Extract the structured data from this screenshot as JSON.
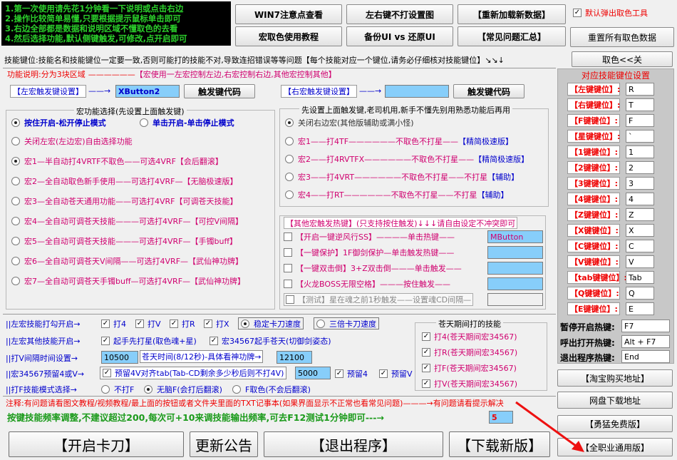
{
  "intro_lines": [
    "1.第一次使用请先花1分钟看一下说明或点击右边",
    "2.操作比较简单易懂,只要根据提示鼠标单击即可",
    "3.右边全部都是数据和说明区域不懂取色的去看",
    "4.然后选择功能,默认侧键触发,可修改,点开启即可"
  ],
  "top_buttons": {
    "win7": "WIN7注意点查看",
    "lr_key": "左右键不打设置图",
    "reload": "【重新加载新数据】",
    "macro_tutorial": "宏取色使用教程",
    "backup_ui": "备份UI vs 还原UI",
    "faq": "【常见问题汇总】"
  },
  "default_popup": "默认弹出取色工具",
  "reset_colors": "重置所有取色数据",
  "pick_color": "取色<<关",
  "skill_note": "技能键位:技能名和技能键位一定要一致,否则可能打的技能不对,导致连招错误等等问题【每个技能对应一个键位,请务必仔细核对技能键位】↘↘↓",
  "func_note_a": "功能说明:分为3块区域",
  "func_note_b": "【宏使用一左宏控制左边,右宏控制右边,其他宏控制其他】",
  "left_trigger": {
    "label": "【左宏触发键设置】",
    "arrow": "——→",
    "value": "XButton2",
    "code_btn": "触发键代码"
  },
  "right_trigger": {
    "label": "【右宏触发键设置】",
    "arrow": "——→",
    "value": "",
    "code_btn": "触发键代码"
  },
  "left_group": {
    "title": "宏功能选择(先设置上面触发键)",
    "opt_hold": "按住开启-松开停止模式",
    "opt_click": "单击开启-单击停止模式",
    "items": [
      {
        "a": "关闭左宏(左边宏)自由选择功能",
        "b": ""
      },
      {
        "a": "宏1—半自动打4VRTF不取色——可选4VRF",
        "b": "【会后翻滚】"
      },
      {
        "a": "宏2—全自动取色新手使用——可选打4VRF—",
        "b": "【无脑极速版】"
      },
      {
        "a": "宏3—全自动苍天通用功能——可选打4VRF",
        "b": "【可调苍天技能】"
      },
      {
        "a": "宏4—全自动可调苍天技能———可选打4VRF—",
        "b": "【可控V间隔】"
      },
      {
        "a": "宏5—全自动可调苍天技能———可选打4VRF—",
        "b": "【手镯buff】"
      },
      {
        "a": "宏6—全自动可调苍天V间隔——可选打4VRF—",
        "b": "【武仙神功牌】"
      },
      {
        "a": "宏7—全自动可调苍天手镯buff—可选打4VRF—",
        "b": "【武仙神功牌】"
      }
    ]
  },
  "right_group": {
    "title": "先设置上面触发键,老司机用,新手不懂先别用熟悉功能后再用",
    "items": [
      {
        "a": "关闭右边宏(其他版辅助或满小怪)",
        "b": "",
        "c": ""
      },
      {
        "a": "宏1——打4TF——————",
        "b": "不取色不打星——",
        "c": "【精简极速版】"
      },
      {
        "a": "宏2——打4RVTFX——————",
        "b": "不取色不打星——",
        "c": "【精简极速版】"
      },
      {
        "a": "宏3——打4VRT——————",
        "b": "不取色不打星——不打星",
        "c": "【辅助】"
      },
      {
        "a": "宏4——打RT——————",
        "b": "不取色不打星——不打星",
        "c": "【辅助】"
      }
    ]
  },
  "other_hotkeys": {
    "title": "【其他宏触发热键】(只支持按住触发)↓↓↓请自由设定不冲突即可",
    "items": [
      {
        "label": "【开启一键逆风行SS】",
        "mid": "————单击热键——",
        "value": "MButton",
        "checked": false
      },
      {
        "label": "【一键保护】1F御剑保护—",
        "mid": "单击触发热键——",
        "value": "",
        "checked": false
      },
      {
        "label": "【一键双击倒】3+Z双击倒",
        "mid": "———单击触发——",
        "value": "",
        "checked": false
      },
      {
        "label": "【火龙BOSS无限空格】",
        "mid": "———按住触发——",
        "value": "",
        "checked": false
      },
      {
        "label": "【测试】星在魂之前1秒触发——设置魂CD间隔—",
        "mid": "",
        "value": "",
        "checked": false
      }
    ]
  },
  "bottom_rows": {
    "r1_label": "||左宏技能打勾开启→",
    "r1_skills": [
      "打4",
      "打V",
      "打R",
      "打X"
    ],
    "r1_opt1": "稳定卡刀速度",
    "r1_opt2": "三倍卡刀速度",
    "r2_label": "||左宏其他技能开启→",
    "r2_opt1": "起手先打星(取色魂+星)",
    "r2_opt2": "宏34567起手苍天(切御剑姿态)",
    "r3_label": "||打V间隔时间设置→",
    "r3_val1": "10500",
    "r3_mid": "苍天时间(8/12秒)-具体看神功牌→",
    "r3_val2": "12100",
    "r4_label": "||宏34567预留4或V→",
    "r4_opt1": "预留4V对齐tab(Tab-CD剩余多少秒后则不打4V)",
    "r4_val": "5000",
    "r4_opt2": "预留4",
    "r4_opt3": "预留V",
    "r5_label": "||打F技能模式选择→",
    "r5_opt1": "不打F",
    "r5_opt2": "无脑F(会打后翻滚)",
    "r5_opt3": "F取色(不会后翻滚)"
  },
  "cangtian": {
    "title": "苍天期间打的技能",
    "items": [
      "打4(苍天期间宏34567)",
      "打R(苍天期间宏34567)",
      "打F(苍天期间宏34567)",
      "打V(苍天期间宏34567)"
    ]
  },
  "note_line": "注释:有问题请看图文教程/视频教程/最上面的按钮或者文件夹里面的TXT记事本(如果界面显示不正常也看常见问题)———→有问题请看提示解决",
  "freq_line": "按键技能频率调整,不建议超过200,每次可+10来调技能输出频率,可去F12测试1分钟即可---→",
  "freq_value": "5",
  "bottom_buttons": {
    "start": "【开启卡刀】",
    "update": "更新公告",
    "exit": "【退出程序】",
    "download": "【下载新版】"
  },
  "side": {
    "title": "对应技能键位设置",
    "keys": [
      {
        "label": "【左键键位】:",
        "value": "R"
      },
      {
        "label": "【右键键位】:",
        "value": "T"
      },
      {
        "label": "【F键键位】:",
        "value": "F"
      },
      {
        "label": "【星键键位】:",
        "value": "`"
      },
      {
        "label": "【1键键位】:",
        "value": "1"
      },
      {
        "label": "【2键键位】:",
        "value": "2"
      },
      {
        "label": "【3键键位】:",
        "value": "3"
      },
      {
        "label": "【4键键位】:",
        "value": "4"
      },
      {
        "label": "【Z键键位】:",
        "value": "Z"
      },
      {
        "label": "【X键键位】:",
        "value": "X"
      },
      {
        "label": "【C键键位】:",
        "value": "C"
      },
      {
        "label": "【V键键位】:",
        "value": "V"
      },
      {
        "label": "【tab键键位】:",
        "value": "Tab"
      },
      {
        "label": "【Q键键位】:",
        "value": "Q"
      },
      {
        "label": "【E键键位】:",
        "value": "E"
      }
    ],
    "pause_label": "暂停开启热键:",
    "pause_value": "F7",
    "call_label": "呼出打开热键:",
    "call_value": "Alt + F7",
    "exitp_label": "退出程序热键:",
    "exitp_value": "End",
    "taobao": "【淘宝购买地址】",
    "netdisk": "网盘下载地址",
    "brave": "【勇猛免费版】",
    "allclass": "【全职业通用版】"
  }
}
